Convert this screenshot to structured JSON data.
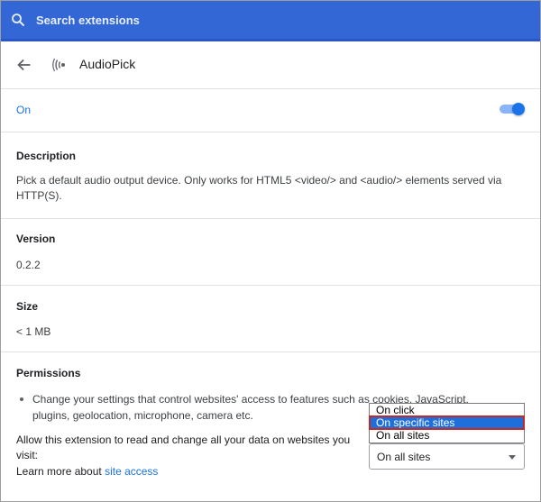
{
  "search": {
    "placeholder": "Search extensions"
  },
  "extension": {
    "name": "AudioPick"
  },
  "status": {
    "label": "On",
    "enabled": true
  },
  "description": {
    "title": "Description",
    "text": "Pick a default audio output device. Only works for HTML5 <video/> and <audio/> elements served via HTTP(S)."
  },
  "version": {
    "title": "Version",
    "value": "0.2.2"
  },
  "size": {
    "title": "Size",
    "value": "< 1 MB"
  },
  "permissions": {
    "title": "Permissions",
    "item": "Change your settings that control websites' access to features such as cookies, JavaScript, plugins, geolocation, microphone, camera etc."
  },
  "site_access": {
    "allow_text": "Allow this extension to read and change all your data on websites you visit:",
    "learn_more_prefix": "Learn more about ",
    "link_text": "site access",
    "selected_value": "On all sites",
    "options": [
      "On click",
      "On specific sites",
      "On all sites"
    ],
    "highlighted_option": "On specific sites"
  },
  "colors": {
    "header": "#3367d6",
    "accent": "#1a73e8",
    "highlight_border": "#c62828"
  }
}
